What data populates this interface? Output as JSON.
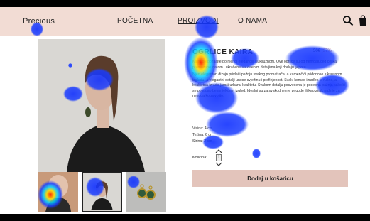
{
  "nav": {
    "brand": "Precious",
    "items": [
      "POČETNA",
      "PROIZVODI",
      "O NAMA"
    ],
    "icons": [
      "search-icon",
      "bag-icon"
    ],
    "accent_color": "#f2dcd4"
  },
  "product": {
    "title": "OGRLICE KAIRA",
    "price": "50€",
    "discount": "(37%",
    "description": [
      "Kairu prepoznajte po njenoj eleganciji i luksuznom. Ove ogrlice su od nehrđajućeg čelika premazane zlatom i ukrašene sa zelenim detaljima koji dodaju ljepotu.",
      "Njen elegantan dizajn privlači pažnju svakog promatrača, a kamenčići pridonose luksuznom izgledu, a elegantni detalji unose svježinu i profinjenost. Svaki komad izrađen je ručno, a kvalitetna izrada jamči urbanu kvalitetu. Svakom detalju posvećena je posebna pažnja kako bi se postigao besprijekoran izgled. Idealni su za svakodnevne prigode ili kao znak pažnje za nekoga koga volite."
    ],
    "specs": [
      "Visina: 4 cm",
      "Težina: 6 gr",
      "Širina: 2 cm"
    ],
    "quantity_label": "Količina:",
    "quantity_value": "1",
    "add_to_cart_label": "Dodaj u košaricu",
    "button_color": "#e3c4bb"
  },
  "gallery": {
    "thumbnails": [
      "thumbnail-1",
      "thumbnail-2",
      "thumbnail-3"
    ],
    "selected_index": 1
  }
}
